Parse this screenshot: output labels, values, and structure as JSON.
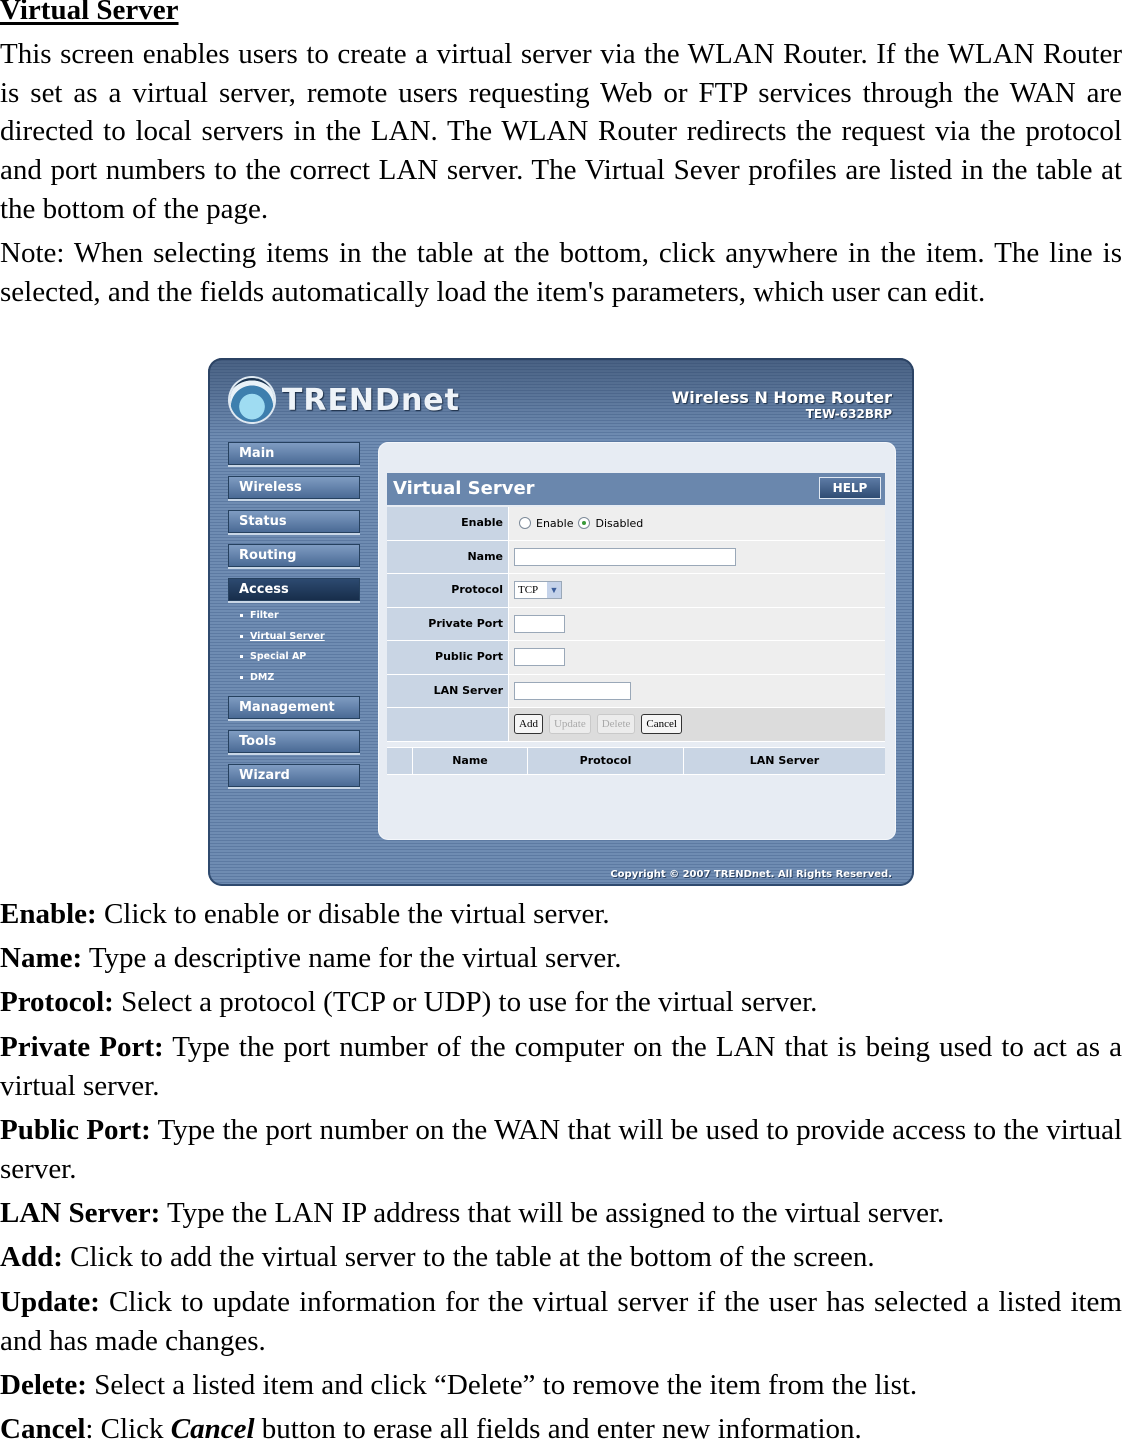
{
  "doc": {
    "title": "Virtual Server",
    "intro": "This screen enables users to create a virtual server via the WLAN Router. If the WLAN Router is set as a virtual server, remote users requesting Web or FTP services through the WAN are directed to local servers in the LAN. The WLAN Router redirects the request via the protocol and port numbers to the correct LAN server. The Virtual Sever profiles are listed in the table at the bottom of the page.",
    "note": "Note: When selecting items in the table at the bottom, click anywhere in the item. The line is selected, and the fields automatically load the item's parameters, which user can edit.",
    "descriptions": [
      {
        "term": "Enable:",
        "text": " Click to enable or disable the virtual server."
      },
      {
        "term": "Name:",
        "text": " Type a descriptive name for the virtual server."
      },
      {
        "term": "Protocol:",
        "text": " Select a protocol (TCP or UDP) to use for the virtual server."
      },
      {
        "term": "Private Port:",
        "text": " Type the port number of the computer on the LAN that is being used to act as a virtual server."
      },
      {
        "term": "Public Port:",
        "text": " Type the port number on the WAN that will be used to provide access to the virtual server."
      },
      {
        "term": "LAN Server:",
        "text": " Type the LAN IP address that will be assigned to the virtual server."
      },
      {
        "term": "Add:",
        "text": " Click to add the virtual server to the table at the bottom of the screen."
      },
      {
        "term": "Update:",
        "text": " Click to update information for the virtual server if the user has selected a listed item and has made changes."
      },
      {
        "term": "Delete:",
        "text": " Select a listed item and click “Delete” to remove the item from the list."
      },
      {
        "term": "Cancel",
        "text": ": Click ",
        "em": "Cancel",
        "tail": " button to erase all fields and enter new information."
      }
    ]
  },
  "router": {
    "brand": "TRENDnet",
    "product_line": "Wireless N Home Router",
    "model": "TEW-632BRP",
    "copyright": "Copyright © 2007 TRENDnet. All Rights Reserved.",
    "nav": [
      {
        "label": "Main"
      },
      {
        "label": "Wireless"
      },
      {
        "label": "Status"
      },
      {
        "label": "Routing"
      },
      {
        "label": "Access",
        "active": true
      },
      {
        "label": "Management"
      },
      {
        "label": "Tools"
      },
      {
        "label": "Wizard"
      }
    ],
    "subnav": [
      {
        "label": "Filter"
      },
      {
        "label": "Virtual Server",
        "current": true
      },
      {
        "label": "Special AP"
      },
      {
        "label": "DMZ"
      }
    ],
    "panel": {
      "title": "Virtual Server",
      "help_label": "HELP",
      "fields": {
        "enable_label": "Enable",
        "enable_option": "Enable",
        "disabled_option": "Disabled",
        "enable_selected": "Disabled",
        "name_label": "Name",
        "name_value": "",
        "protocol_label": "Protocol",
        "protocol_value": "TCP",
        "private_port_label": "Private Port",
        "private_port_value": "",
        "public_port_label": "Public Port",
        "public_port_value": "",
        "lan_server_label": "LAN Server",
        "lan_server_value": ""
      },
      "buttons": {
        "add": "Add",
        "update": "Update",
        "delete": "Delete",
        "cancel": "Cancel"
      },
      "table_headers": [
        "Name",
        "Protocol",
        "LAN Server"
      ]
    }
  }
}
